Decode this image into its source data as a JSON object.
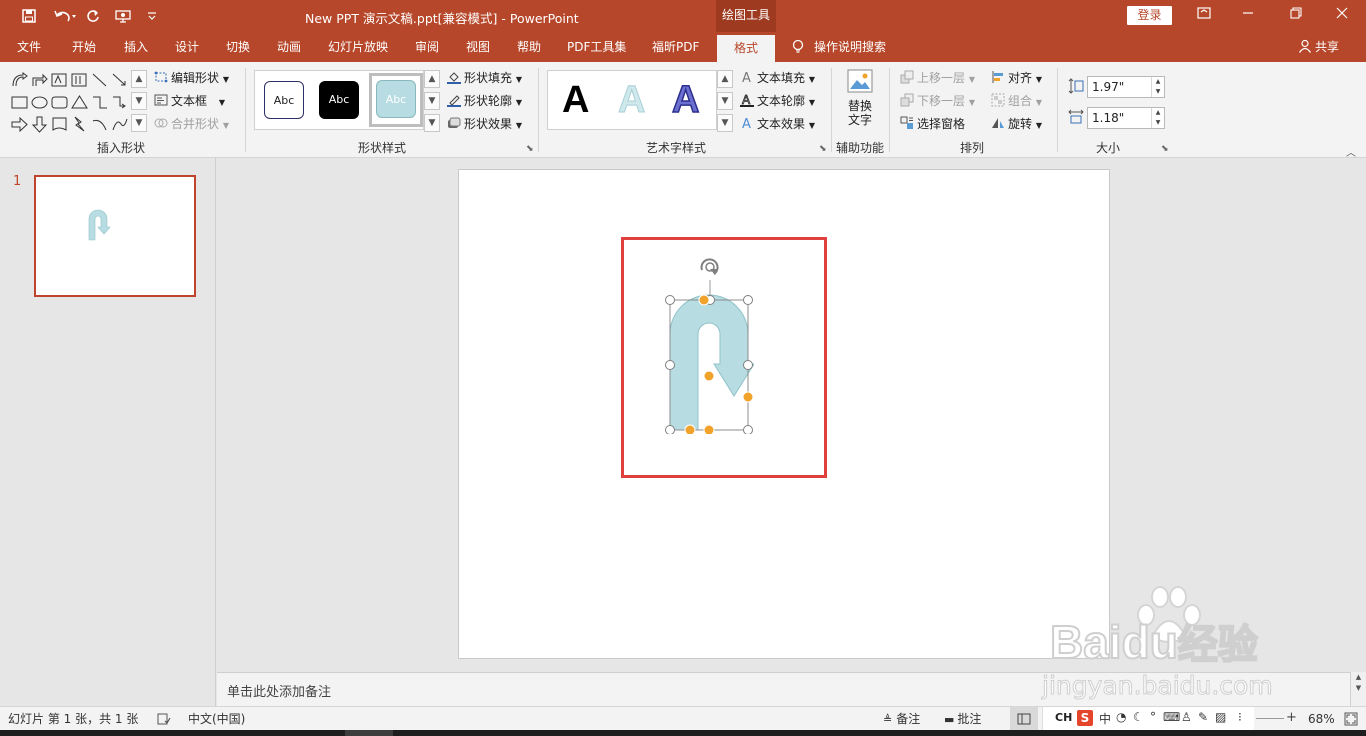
{
  "titlebar": {
    "qat": {
      "save": "save-icon",
      "undo": "undo-icon",
      "redo": "repeat-icon",
      "present": "present-from-start-icon",
      "customize": "customize-qat-icon"
    },
    "document_title": "New PPT 演示文稿.ppt[兼容模式]  -  PowerPoint",
    "contextual_tab": "绘图工具",
    "login": "登录"
  },
  "tabs": [
    "文件",
    "开始",
    "插入",
    "设计",
    "切换",
    "动画",
    "幻灯片放映",
    "审阅",
    "视图",
    "帮助",
    "PDF工具集",
    "福昕PDF"
  ],
  "active_tab": "格式",
  "tell_me": "操作说明搜索",
  "share": "共享",
  "ribbon": {
    "insert_shapes": {
      "label": "插入形状",
      "edit_shape": "编辑形状",
      "text_box": "文本框",
      "merge_shapes": "合并形状"
    },
    "shape_styles": {
      "label": "形状样式",
      "swatches": [
        "Abc",
        "Abc",
        "Abc"
      ],
      "fill": "形状填充",
      "outline": "形状轮廓",
      "effects": "形状效果"
    },
    "wordart": {
      "label": "艺术字样式",
      "letters": [
        "A",
        "A",
        "A"
      ],
      "text_fill": "文本填充",
      "text_outline": "文本轮廓",
      "text_effects": "文本效果"
    },
    "accessibility": {
      "label": "辅助功能",
      "alt_text_line1": "替换",
      "alt_text_line2": "文字"
    },
    "arrange": {
      "label": "排列",
      "bring_forward": "上移一层",
      "send_backward": "下移一层",
      "selection_pane": "选择窗格",
      "align": "对齐",
      "group": "组合",
      "rotate": "旋转"
    },
    "size": {
      "label": "大小",
      "height": "1.97\"",
      "width": "1.18\""
    }
  },
  "slides": {
    "thumb_number": "1"
  },
  "notes_placeholder": "单击此处添加备注",
  "statusbar": {
    "slide_info": "幻灯片 第 1 张，共 1 张",
    "language": "中文(中国)",
    "notes": "备注",
    "comments": "批注",
    "ime": "CH",
    "zoom": "68%"
  },
  "watermark": {
    "brand": "Bai",
    "brand2": "du",
    "cn": "经验",
    "url": "jingyan.baidu.com"
  },
  "colors": {
    "accent": "#b7472a",
    "shape_fill": "#b7dde2",
    "shape_stroke": "#6fa9b0",
    "selection_box": "#e0403d",
    "handle": "#f0a22b"
  }
}
